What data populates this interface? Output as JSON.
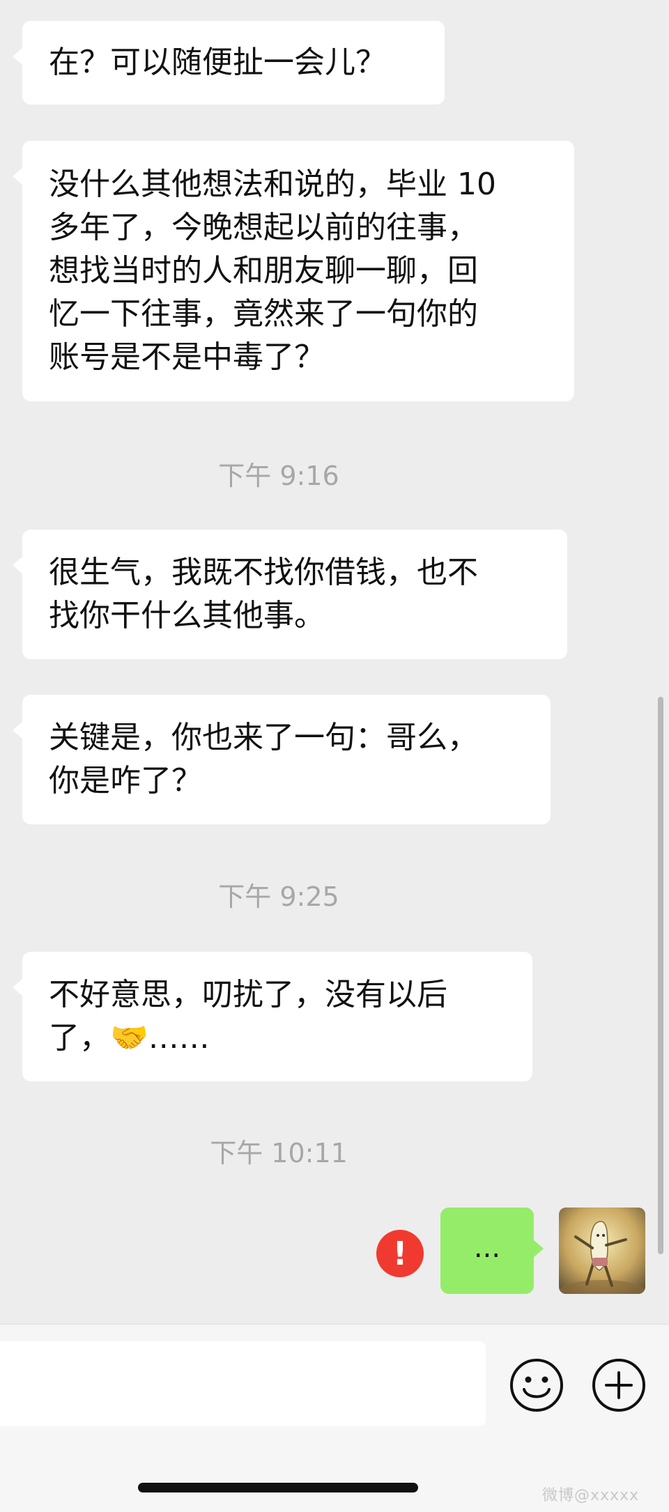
{
  "messages_in": [
    {
      "lines": [
        "在？可以随便扯一会儿？"
      ]
    },
    {
      "lines": [
        "没什么其他想法和说的，毕业 10",
        "多年了，今晚想起以前的往事，",
        "想找当时的人和朋友聊一聊，回",
        "忆一下往事，竟然来了一句你的",
        "账号是不是中毒了？"
      ]
    },
    {
      "lines": [
        "很生气，我既不找你借钱，也不",
        "找你干什么其他事。"
      ]
    },
    {
      "lines": [
        "关键是，你也来了一句：哥么，",
        "你是咋了？"
      ]
    },
    {
      "lines": [
        "不好意思，叨扰了，没有以后",
        "了，🤝……"
      ]
    }
  ],
  "timestamps": [
    "下午 9:16",
    "下午 9:25",
    "下午 10:11"
  ],
  "message_out": {
    "text": "...",
    "status_icon": "exclamation",
    "status_color": "#f13a2f",
    "bubble_color": "#95ec69"
  },
  "input": {
    "value": "",
    "placeholder": ""
  },
  "icons": {
    "emoji_button": "smiley-face-icon",
    "more_button": "plus-circle-icon"
  },
  "watermark": "微博@xxxxx"
}
